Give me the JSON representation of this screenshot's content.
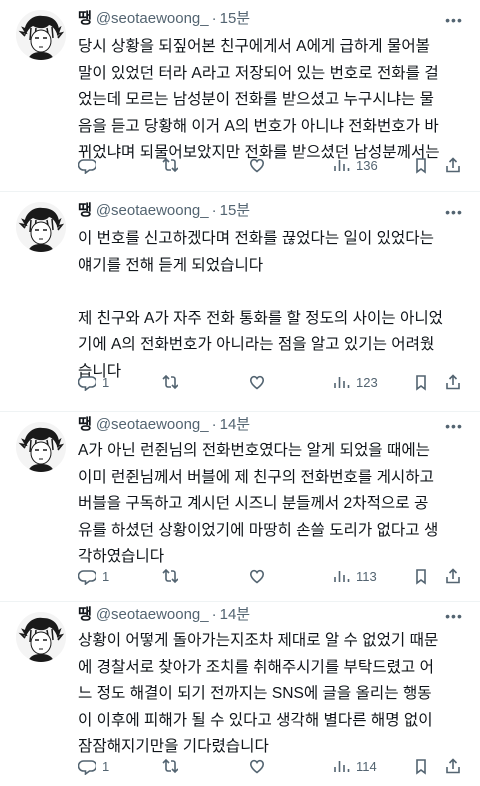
{
  "tweets": [
    {
      "name": "땡",
      "handle": "@seotaewoong_",
      "time": "15분",
      "text": "당시 상황을 되짚어본 친구에게서 A에게 급하게 물어볼\n말이 있었던 터라 A라고 저장되어 있는 번호로 전화를 걸\n었는데 모르는 남성분이 전화를 받으셨고 누구시냐는 물\n음을 듣고 당황해 이거 A의 번호가 아니냐 전화번호가 바\n뀌었냐며 되물어보았지만 전화를 받으셨던 남성분께서는",
      "replies": "",
      "retweets": "",
      "likes": "",
      "views": "136"
    },
    {
      "name": "땡",
      "handle": "@seotaewoong_",
      "time": "15분",
      "text": "이 번호를 신고하겠다며 전화를 끊었다는 일이 있었다는\n얘기를 전해 듣게 되었습니다\n\n제 친구와 A가 자주 전화 통화를 할 정도의 사이는 아니었\n기에 A의 전화번호가 아니라는 점을 알고 있기는 어려웠\n습니다",
      "replies": "1",
      "retweets": "",
      "likes": "",
      "views": "123"
    },
    {
      "name": "땡",
      "handle": "@seotaewoong_",
      "time": "14분",
      "text": "A가 아닌 런쥔님의 전화번호였다는 알게 되었을 때에는\n이미 런쥔님께서 버블에 제 친구의 전화번호를 게시하고\n버블을 구독하고 계시던 시즈니 분들께서 2차적으로 공\n유를 하셨던 상황이었기에 마땅히 손쓸 도리가 없다고 생\n각하였습니다",
      "replies": "1",
      "retweets": "",
      "likes": "",
      "views": "113"
    },
    {
      "name": "땡",
      "handle": "@seotaewoong_",
      "time": "14분",
      "text": "상황이 어떻게 돌아가는지조차 제대로 알 수 없었기 때문\n에 경찰서로 찾아가 조치를 취해주시기를 부탁드렸고 어\n느 정도 해결이 되기 전까지는 SNS에 글을 올리는 행동\n이 이후에 피해가 될 수 있다고 생각해 별다른 해명 없이\n잠잠해지기만을 기다렸습니다",
      "replies": "1",
      "retweets": "",
      "likes": "",
      "views": "114"
    }
  ],
  "icons": {
    "reply": "reply-icon",
    "retweet": "retweet-icon",
    "like": "like-icon",
    "views": "views-icon",
    "bookmark": "bookmark-icon",
    "share": "share-icon",
    "more": "more-icon"
  },
  "colors": {
    "text": "#0f1419",
    "secondary": "#536471",
    "divider": "#eff3f4"
  }
}
